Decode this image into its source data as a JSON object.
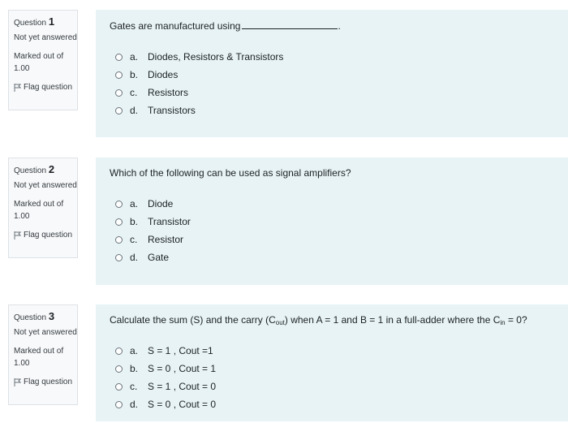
{
  "questions": [
    {
      "label": "Question",
      "number": "1",
      "status": "Not yet answered",
      "marks": "Marked out of 1.00",
      "flag": "Flag question",
      "text": "Gates are manufactured using",
      "text_after_blank": ".",
      "answers": [
        {
          "letter": "a.",
          "text": "Diodes, Resistors & Transistors"
        },
        {
          "letter": "b.",
          "text": "Diodes"
        },
        {
          "letter": "c.",
          "text": "Resistors"
        },
        {
          "letter": "d.",
          "text": "Transistors"
        }
      ]
    },
    {
      "label": "Question",
      "number": "2",
      "status": "Not yet answered",
      "marks": "Marked out of 1.00",
      "flag": "Flag question",
      "text": "Which of the following can be used as signal amplifiers?",
      "answers": [
        {
          "letter": "a.",
          "text": "Diode"
        },
        {
          "letter": "b.",
          "text": "Transistor"
        },
        {
          "letter": "c.",
          "text": "Resistor"
        },
        {
          "letter": "d.",
          "text": "Gate"
        }
      ]
    },
    {
      "label": "Question",
      "number": "3",
      "status": "Not yet answered",
      "marks": "Marked out of 1.00",
      "flag": "Flag question",
      "text_part1": "Calculate the sum (S) and the carry (C",
      "sub1": "out",
      "text_part2": ") when A = 1 and B = 1 in a full-adder where the  C",
      "sub2": "in",
      "text_part3": " = 0?",
      "answers": [
        {
          "letter": "a.",
          "text": "S = 1 , Cout =1"
        },
        {
          "letter": "b.",
          "text": "S = 0 , Cout = 1"
        },
        {
          "letter": "c.",
          "text": "S = 1 , Cout = 0"
        },
        {
          "letter": "d.",
          "text": "S = 0 , Cout = 0"
        }
      ]
    }
  ]
}
